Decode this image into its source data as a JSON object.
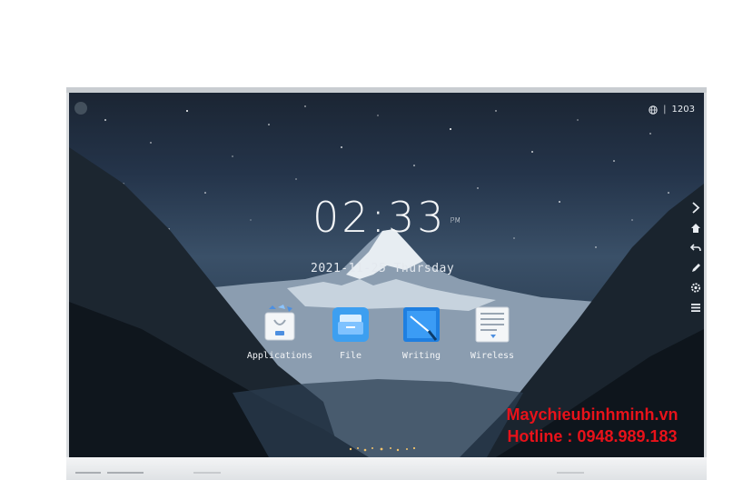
{
  "status_bar": {
    "network_icon": "globe-icon",
    "separator": "|",
    "counter": "1203"
  },
  "clock": {
    "time": "02:33",
    "ampm": "PM"
  },
  "date": "2021-11-25 Thursday",
  "apps": [
    {
      "label": "Applications",
      "icon": "applications-bag-icon"
    },
    {
      "label": "File",
      "icon": "folder-icon"
    },
    {
      "label": "Writing",
      "icon": "writing-board-icon"
    },
    {
      "label": "Wireless",
      "icon": "wireless-projection-icon"
    }
  ],
  "sidebar": [
    "chevron-right-icon",
    "home-icon",
    "back-icon",
    "pen-icon",
    "settings-icon",
    "menu-icon"
  ],
  "watermark": {
    "line1": "Maychieubinhminh.vn",
    "line2": "Hotline : 0948.989.183"
  },
  "colors": {
    "watermark": "#e8121a",
    "screen_sky": "#24344a",
    "text": "#f2f4f6"
  }
}
